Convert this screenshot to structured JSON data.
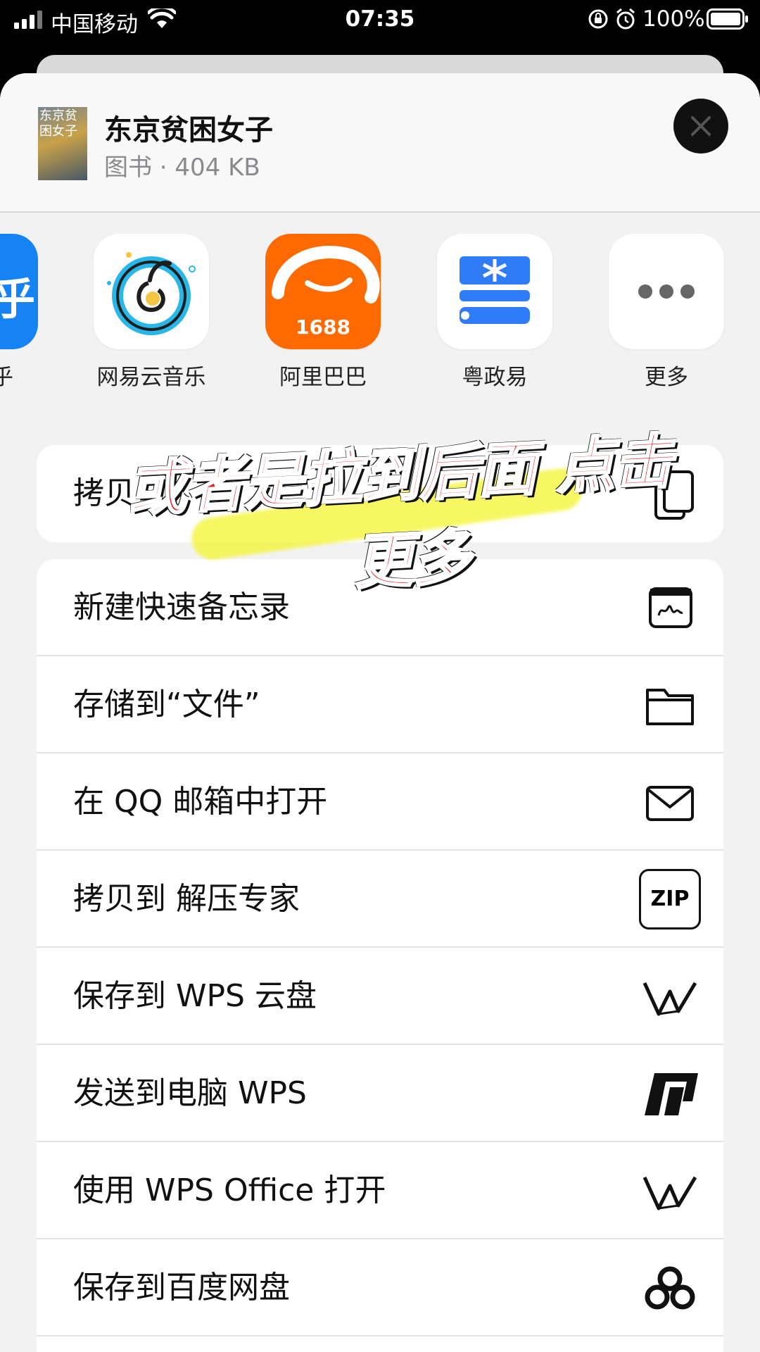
{
  "status_bar": {
    "carrier": "中国移动",
    "time": "07:35",
    "battery_pct": "100%"
  },
  "header": {
    "thumbnail_text": "东京贫困女子",
    "title": "东京贫困女子",
    "subtitle": "图书 · 404 KB"
  },
  "apps": {
    "partial_icon_glyph": "乎",
    "partial_label": "乎",
    "items": [
      {
        "label": "网易云音乐",
        "icon": "netease-music-icon"
      },
      {
        "label": "阿里巴巴",
        "icon": "alibaba-1688-icon",
        "badge": "1688"
      },
      {
        "label": "粤政易",
        "icon": "yuezhengyi-icon"
      },
      {
        "label": "更多",
        "icon": "more-icon"
      }
    ]
  },
  "actions": {
    "copy": {
      "label": "拷贝",
      "icon": "copy-icon"
    },
    "items": [
      {
        "label": "新建快速备忘录",
        "icon": "quick-note-icon"
      },
      {
        "label": "存储到“文件”",
        "icon": "folder-icon"
      },
      {
        "label": "在 QQ 邮箱中打开",
        "icon": "mail-icon"
      },
      {
        "label": "拷贝到 解压专家",
        "icon": "zip-icon",
        "icon_text": "ZIP"
      },
      {
        "label": "保存到 WPS 云盘",
        "icon": "wps-cloud-icon"
      },
      {
        "label": "发送到电脑 WPS",
        "icon": "wps-pc-icon"
      },
      {
        "label": "使用 WPS Office 打开",
        "icon": "wps-office-icon"
      },
      {
        "label": "保存到百度网盘",
        "icon": "baidu-netdisk-icon"
      }
    ]
  },
  "overlay": {
    "line1": "或者是拉到后面 点击",
    "line2": "更多",
    "color": "#e81e2c"
  }
}
